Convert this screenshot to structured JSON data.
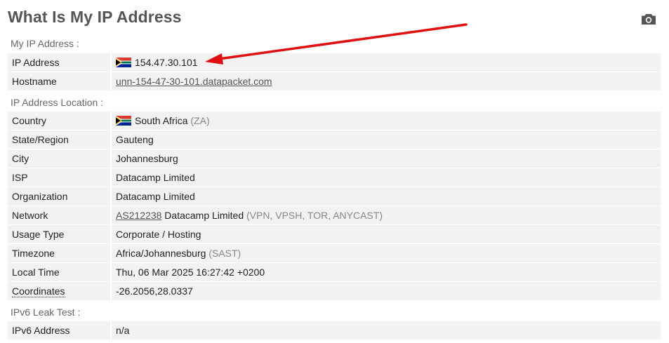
{
  "page": {
    "title": "What Is My IP Address"
  },
  "sections": {
    "my_ip": "My IP Address :",
    "location": "IP Address Location :",
    "ipv6": "IPv6 Leak Test :"
  },
  "my_ip": {
    "ip_label": "IP Address",
    "ip_value": "154.47.30.101",
    "hostname_label": "Hostname",
    "hostname_value": "unn-154-47-30-101.datapacket.com"
  },
  "location": {
    "country_label": "Country",
    "country_value": "South Africa",
    "country_code": "(ZA)",
    "region_label": "State/Region",
    "region_value": "Gauteng",
    "city_label": "City",
    "city_value": "Johannesburg",
    "isp_label": "ISP",
    "isp_value": "Datacamp Limited",
    "org_label": "Organization",
    "org_value": "Datacamp Limited",
    "network_label": "Network",
    "network_asn": "AS212238",
    "network_name": "Datacamp Limited",
    "network_tags": "(VPN, VPSH, TOR, ANYCAST)",
    "usage_label": "Usage Type",
    "usage_value": "Corporate / Hosting",
    "tz_label": "Timezone",
    "tz_value": "Africa/Johannesburg",
    "tz_abbr": "(SAST)",
    "time_label": "Local Time",
    "time_value": "Thu, 06 Mar 2025 16:27:42 +0200",
    "coords_label": "Coordinates",
    "coords_value": "-26.2056,28.0337"
  },
  "ipv6": {
    "label": "IPv6 Address",
    "value": "n/a"
  },
  "icons": {
    "camera": "camera-icon",
    "flag": "south-africa-flag-icon",
    "arrow": "red-arrow-annotation"
  },
  "colors": {
    "row_bg": "#f2f2f2",
    "arrow": "#e01010",
    "title": "#555555"
  }
}
